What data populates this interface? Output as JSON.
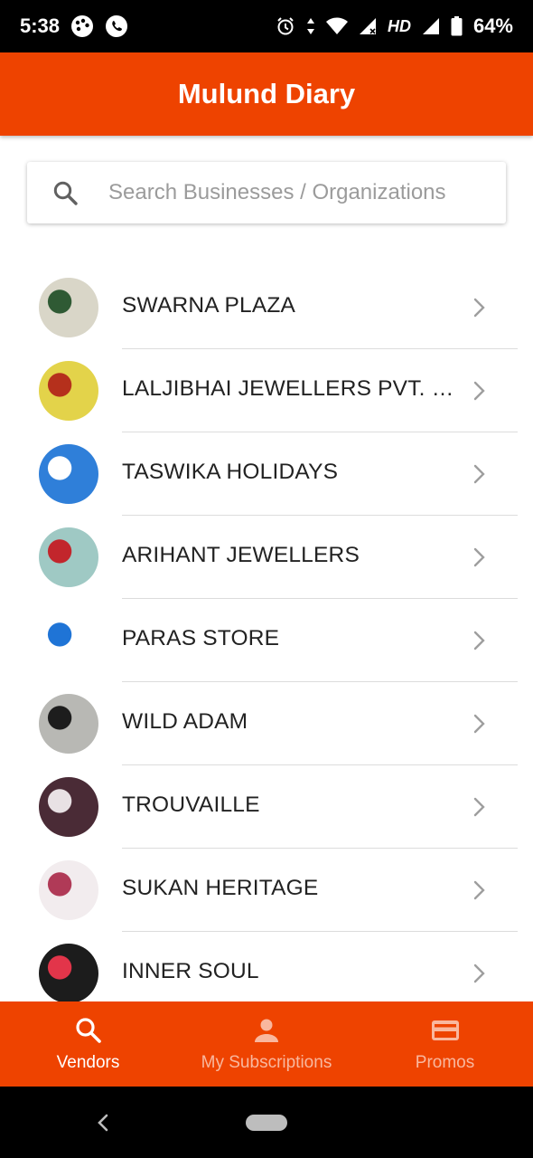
{
  "status_bar": {
    "time": "5:38",
    "network_label": "HD",
    "battery": "64%",
    "icons": [
      "game-icon",
      "whatsapp-icon",
      "alarm-icon",
      "data-arrows-icon",
      "wifi-icon",
      "signal-no-data-icon",
      "signal-icon",
      "battery-icon"
    ]
  },
  "app_bar": {
    "title": "Mulund Diary"
  },
  "search": {
    "placeholder": "Search Businesses / Organizations",
    "value": ""
  },
  "vendors": [
    {
      "name": "SWARNA PLAZA",
      "avatar_colors": [
        "#d9d6c8",
        "#2f5a34"
      ]
    },
    {
      "name": "LALJIBHAI JEWELLERS PVT. LTD.",
      "avatar_colors": [
        "#e3d34a",
        "#b5301c"
      ]
    },
    {
      "name": "TASWIKA HOLIDAYS",
      "avatar_colors": [
        "#2f7fd9",
        "#ffffff"
      ]
    },
    {
      "name": "ARIHANT JEWELLERS",
      "avatar_colors": [
        "#9fc9c4",
        "#c2262c"
      ]
    },
    {
      "name": "PARAS STORE",
      "avatar_colors": [
        "#ffffff",
        "#1f74d6"
      ]
    },
    {
      "name": "WILD ADAM",
      "avatar_colors": [
        "#b8b8b4",
        "#1d1d1d"
      ]
    },
    {
      "name": "TROUVAILLE",
      "avatar_colors": [
        "#4a2b36",
        "#e8e1e4"
      ]
    },
    {
      "name": "SUKAN HERITAGE",
      "avatar_colors": [
        "#f2ecee",
        "#b03a57"
      ]
    },
    {
      "name": "INNER SOUL",
      "avatar_colors": [
        "#1c1c1c",
        "#e2354a"
      ]
    }
  ],
  "bottom_nav": {
    "items": [
      {
        "label": "Vendors",
        "icon": "search-icon",
        "active": true
      },
      {
        "label": "My Subscriptions",
        "icon": "person-icon",
        "active": false
      },
      {
        "label": "Promos",
        "icon": "card-icon",
        "active": false
      }
    ]
  },
  "colors": {
    "accent": "#ee4300",
    "status_bar": "#000000",
    "text_primary": "#222222",
    "placeholder": "#9b9b9b",
    "divider": "#dcdcdc"
  }
}
